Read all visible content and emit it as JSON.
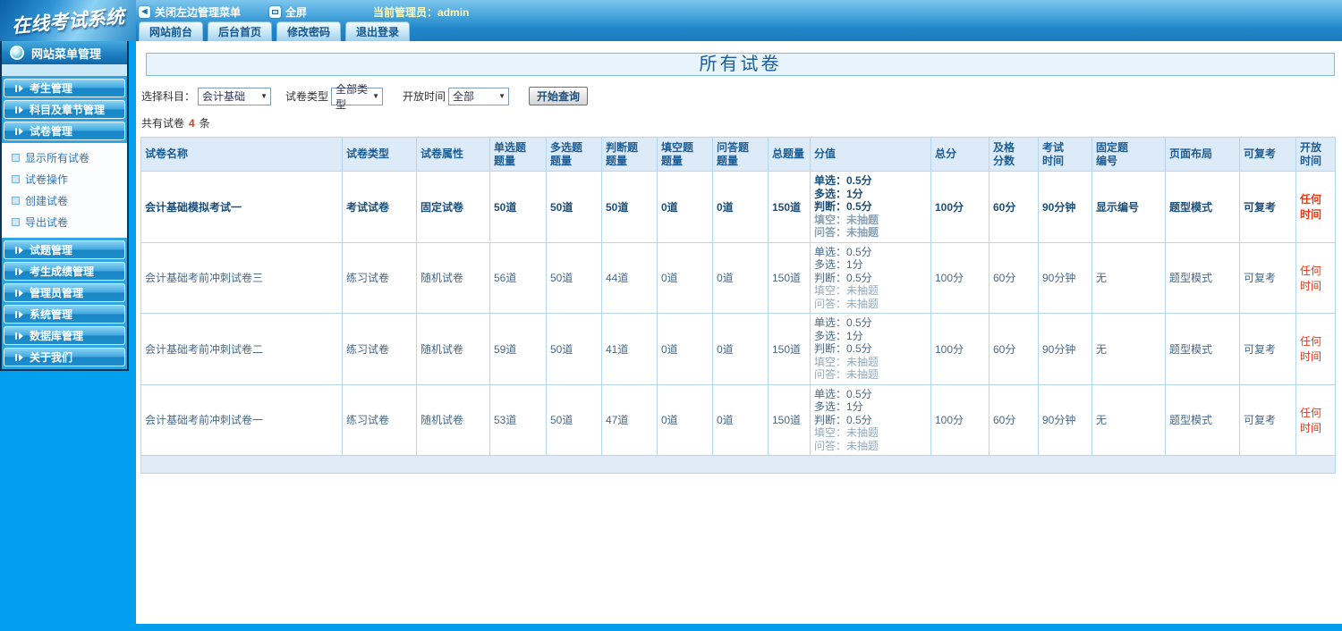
{
  "topbar": {
    "logo": "在线考试系统",
    "menu": {
      "close_left": "关闭左边管理菜单",
      "fullscreen": "全屏",
      "admin": "当前管理员：admin"
    },
    "tabs": [
      "网站前台",
      "后台首页",
      "修改密码",
      "退出登录"
    ]
  },
  "sidebar": {
    "header": "网站菜单管理",
    "groups": [
      "考生管理",
      "科目及章节管理",
      "试卷管理",
      "试题管理",
      "考生成绩管理",
      "管理员管理",
      "系统管理",
      "数据库管理",
      "关于我们"
    ],
    "submenu": [
      "显示所有试卷",
      "试卷操作",
      "创建试卷",
      "导出试卷"
    ]
  },
  "main": {
    "title": "所有试卷",
    "filters": {
      "subject_label": "选择科目：",
      "subject_value": "会计基础",
      "type_label": "试卷类型",
      "type_value": "全部类型",
      "time_label": "开放时间",
      "time_value": "全部",
      "query_button": "开始查询"
    },
    "count": {
      "prefix": "共有试卷",
      "value": "4",
      "suffix": "条"
    },
    "table": {
      "headers": [
        "试卷名称",
        "试卷类型",
        "试卷属性",
        "单选题\n题量",
        "多选题\n题量",
        "判断题\n题量",
        "填空题\n题量",
        "问答题\n题量",
        "总题量",
        "分值",
        "总分",
        "及格\n分数",
        "考试\n时间",
        "固定题\n编号",
        "页面布局",
        "可复考",
        "开放时间"
      ],
      "rows": [
        {
          "name": "会计基础模拟考试一",
          "type": "考试试卷",
          "attr": "固定试卷",
          "single": "50道",
          "multi": "50道",
          "judge": "50道",
          "blank": "0道",
          "qa": "0道",
          "total": "150道",
          "score_lines": [
            "单选：0.5分",
            "多选：1分",
            "判断：0.5分",
            "填空：未抽题",
            "问答：未抽题"
          ],
          "total_score": "100分",
          "pass_score": "60分",
          "exam_time": "90分钟",
          "fixed_no": "显示编号",
          "layout": "题型模式",
          "retake": "可复考",
          "open_time": "任何时间"
        },
        {
          "name": "会计基础考前冲刺试卷三",
          "type": "练习试卷",
          "attr": "随机试卷",
          "single": "56道",
          "multi": "50道",
          "judge": "44道",
          "blank": "0道",
          "qa": "0道",
          "total": "150道",
          "score_lines": [
            "单选：0.5分",
            "多选：1分",
            "判断：0.5分",
            "填空：未抽题",
            "问答：未抽题"
          ],
          "total_score": "100分",
          "pass_score": "60分",
          "exam_time": "90分钟",
          "fixed_no": "无",
          "layout": "题型模式",
          "retake": "可复考",
          "open_time": "任何时间"
        },
        {
          "name": "会计基础考前冲刺试卷二",
          "type": "练习试卷",
          "attr": "随机试卷",
          "single": "59道",
          "multi": "50道",
          "judge": "41道",
          "blank": "0道",
          "qa": "0道",
          "total": "150道",
          "score_lines": [
            "单选：0.5分",
            "多选：1分",
            "判断：0.5分",
            "填空：未抽题",
            "问答：未抽题"
          ],
          "total_score": "100分",
          "pass_score": "60分",
          "exam_time": "90分钟",
          "fixed_no": "无",
          "layout": "题型模式",
          "retake": "可复考",
          "open_time": "任何时间"
        },
        {
          "name": "会计基础考前冲刺试卷一",
          "type": "练习试卷",
          "attr": "随机试卷",
          "single": "53道",
          "multi": "50道",
          "judge": "47道",
          "blank": "0道",
          "qa": "0道",
          "total": "150道",
          "score_lines": [
            "单选：0.5分",
            "多选：1分",
            "判断：0.5分",
            "填空：未抽题",
            "问答：未抽题"
          ],
          "total_score": "100分",
          "pass_score": "60分",
          "exam_time": "90分钟",
          "fixed_no": "无",
          "layout": "题型模式",
          "retake": "可复考",
          "open_time": "任何时间"
        }
      ]
    }
  },
  "colors": {
    "sidebar_blue": "#019ff0",
    "header_text_blue": "#1c5c94",
    "alert_red": "#e63812",
    "table_border": "#b5d6ef",
    "header_bg": "#dcebf7"
  }
}
